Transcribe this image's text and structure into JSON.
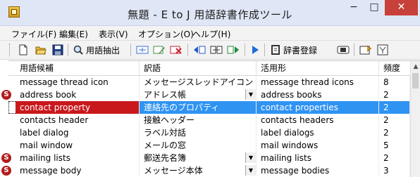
{
  "window": {
    "title": "無題 - E to J 用語辞書作成ツール",
    "min_label": "−",
    "max_label": "□",
    "close_label": "✕"
  },
  "menu": [
    "ファイル(F)",
    "編集(E)",
    "表示(V)",
    "オプション(O)",
    "ヘルプ(H)"
  ],
  "toolbar": {
    "extract_label": "用語抽出",
    "register_label": "辞書登録"
  },
  "grid": {
    "headers": [
      "用語候補",
      "訳語",
      "活用形",
      "頻度"
    ],
    "rows": [
      {
        "term": "message thread icon",
        "translation": "メッセージスレッドアイコン",
        "inflection": "message thread icons",
        "frequency": "8",
        "marker": false,
        "dropdown": false,
        "selected": false
      },
      {
        "term": "address book",
        "translation": "アドレス帳",
        "inflection": "address books",
        "frequency": "2",
        "marker": true,
        "dropdown": true,
        "selected": false
      },
      {
        "term": "contact property",
        "translation": "連絡先のプロパティ",
        "inflection": "contact properties",
        "frequency": "2",
        "marker": false,
        "dropdown": false,
        "selected": true
      },
      {
        "term": "contacts header",
        "translation": "接触ヘッダー",
        "inflection": "contacts headers",
        "frequency": "2",
        "marker": false,
        "dropdown": false,
        "selected": false
      },
      {
        "term": "label dialog",
        "translation": "ラベル対話",
        "inflection": "label dialogs",
        "frequency": "2",
        "marker": false,
        "dropdown": false,
        "selected": false
      },
      {
        "term": "mail window",
        "translation": "メールの窓",
        "inflection": "mail windows",
        "frequency": "5",
        "marker": false,
        "dropdown": false,
        "selected": false
      },
      {
        "term": "mailing lists",
        "translation": "郵送先名簿",
        "inflection": "mailing lists",
        "frequency": "2",
        "marker": true,
        "dropdown": true,
        "selected": false
      },
      {
        "term": "message body",
        "translation": "メッセージ本体",
        "inflection": "message bodies",
        "frequency": "3",
        "marker": true,
        "dropdown": true,
        "selected": false
      }
    ]
  },
  "colors": {
    "selection": "#2f93f2",
    "selected_term_cell": "#c8181c",
    "marker": "#b21d1d",
    "close_button": "#c7413a"
  }
}
